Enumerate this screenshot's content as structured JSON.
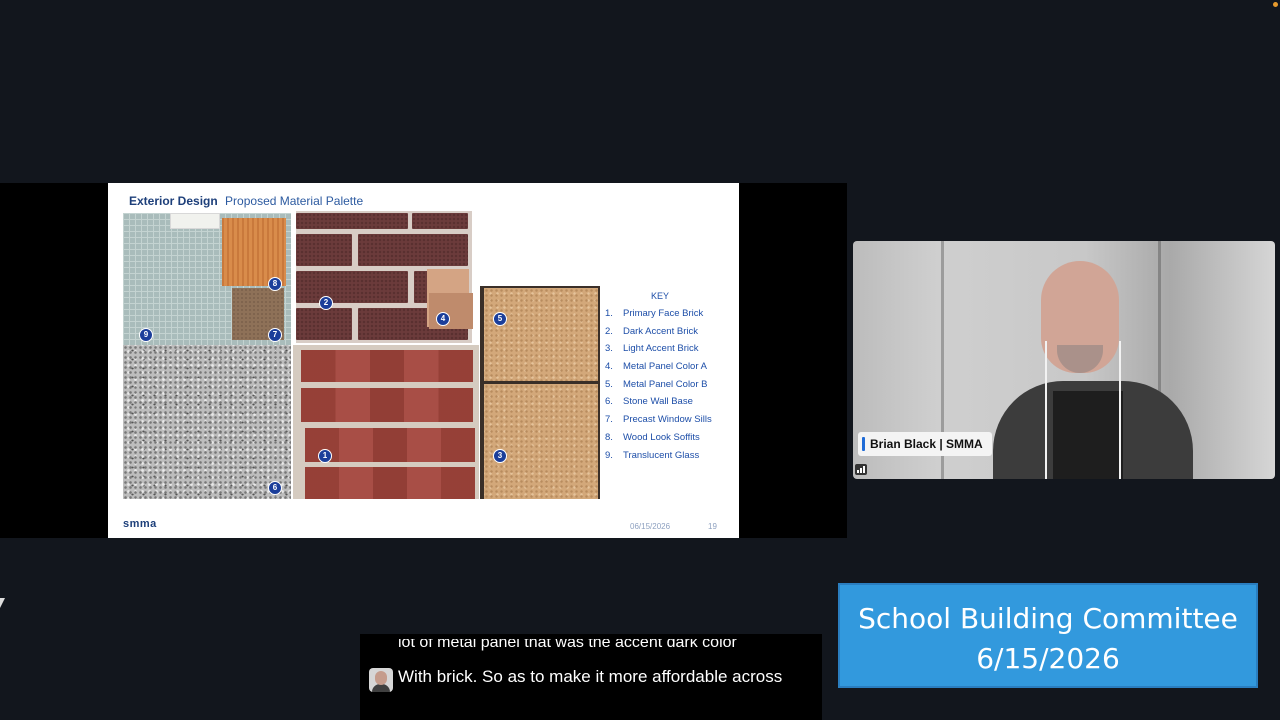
{
  "slide": {
    "title_bold": "Exterior Design",
    "title_rest": "Proposed Material Palette",
    "key_title": "KEY",
    "key_items": [
      {
        "num": "1.",
        "label": "Primary Face Brick"
      },
      {
        "num": "2.",
        "label": "Dark Accent Brick"
      },
      {
        "num": "3.",
        "label": "Light Accent Brick"
      },
      {
        "num": "4.",
        "label": "Metal Panel Color A"
      },
      {
        "num": "5.",
        "label": "Metal Panel Color B"
      },
      {
        "num": "6.",
        "label": "Stone Wall Base"
      },
      {
        "num": "7.",
        "label": "Precast Window Sills"
      },
      {
        "num": "8.",
        "label": "Wood Look Soffits"
      },
      {
        "num": "9.",
        "label": "Translucent Glass"
      }
    ],
    "badges": {
      "b1": "1",
      "b2": "2",
      "b3": "3",
      "b4": "4",
      "b5": "5",
      "b6": "6",
      "b7": "7",
      "b8": "8",
      "b9": "9"
    },
    "logo": "smma",
    "date": "06/15/2026",
    "page": "19"
  },
  "video": {
    "participant_name": "Brian Black | SMMA"
  },
  "caption": {
    "previous_line": "lot of metal panel that was the accent dark color",
    "current_text": "With brick. So as to make it more affordable across"
  },
  "banner": {
    "line1": "School Building Committee",
    "line2": "6/15/2026"
  }
}
